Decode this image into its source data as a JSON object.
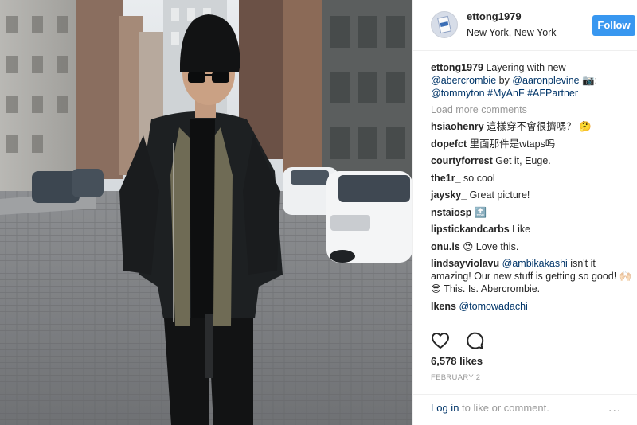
{
  "header": {
    "username": "ettong1979",
    "location": "New York, New York",
    "follow_label": "Follow"
  },
  "caption": {
    "username": "ettong1979",
    "text_1": "Layering with new",
    "mention_1": "@abercrombie",
    "text_2": "by",
    "mention_2": "@aaronplevine",
    "camera_emoji": "📷:",
    "mention_3": "@tommyton",
    "hashtag_1": "#MyAnF",
    "hashtag_2": "#AFPartner"
  },
  "load_more": "Load more comments",
  "comments": [
    {
      "user": "hsiaohenry",
      "text": "這樣穿不會很擠嗎？ 🤔"
    },
    {
      "user": "dopefct",
      "text": "里面那件是wtaps吗"
    },
    {
      "user": "courtyforrest",
      "text": "Get it, Euge."
    },
    {
      "user": "the1r_",
      "text": "so cool"
    },
    {
      "user": "jaysky_",
      "text": "Great picture!"
    },
    {
      "user": "nstaiosp",
      "text": "🔝"
    },
    {
      "user": "lipstickandcarbs",
      "text": "Like"
    },
    {
      "user": "onu.is",
      "text": "😍 Love this."
    },
    {
      "user": "lindsayviolavu",
      "mention": "@ambikakashi",
      "text": "isn't it amazing! Our new stuff is getting so good! 🙌🏻😎 This. Is. Abercrombie."
    },
    {
      "user": "lkens",
      "mention": "@tomowadachi",
      "text": ""
    }
  ],
  "likes": "6,578 likes",
  "date": "FEBRUARY 2",
  "footer": {
    "login_link": "Log in",
    "login_text": "to like or comment.",
    "more": "..."
  },
  "colors": {
    "follow_bg": "#3897f0",
    "link": "#003569",
    "muted": "#999999"
  },
  "icons": [
    "heart-icon",
    "comment-icon",
    "more-options-icon"
  ]
}
